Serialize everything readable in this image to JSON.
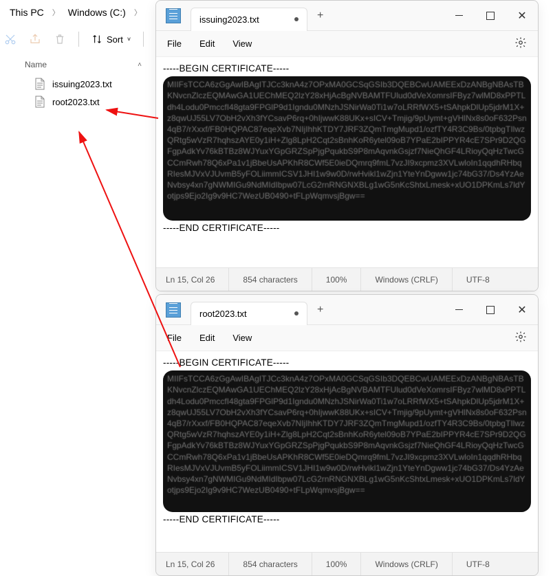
{
  "explorer": {
    "breadcrumbs": [
      "This PC",
      "Windows (C:)"
    ],
    "sort_label": "Sort",
    "name_header": "Name",
    "files": [
      {
        "name": "issuing2023.txt"
      },
      {
        "name": "root2023.txt"
      }
    ]
  },
  "notepad1": {
    "tab_title": "issuing2023.txt",
    "menu": {
      "file": "File",
      "edit": "Edit",
      "view": "View"
    },
    "cert_begin": "-----BEGIN CERTIFICATE-----",
    "cert_end": "-----END CERTIFICATE-----",
    "cert_body": "MIIFsTCCA6zGgAwIBAgITJCc3knA4z7OPxMA0GCSqGSIb3DQEBCwUAMEExDzANBgNBAsTBKNvcnZlczEQMAwGA1UEChMEQ2lzY28xHjAcBgNVBAMTFUlud0dVeXomrsIFByz7wlMD8xPPTLdh4Lodu0PmccfI48gta9FPGlP9d1Igndu0MNzhJSNirWa0Ti1w7oLRRfWX5+tSAhpkDlUp5jdrM1X+z8qwUJ55LV7ObH2vXh3fYCsavP6rq+0hIjwwK88UKx+sICV+Tmjig/9pUymt+gVHlNx8s0oF632Psn4qB7/rXxxf/FB0HQPAC87eqeXvb7NIjIhhKTDY7JRF3ZQmTmgMupd1/ozfTY4R3C9Bs/0tpbgTIlwzQRtg5wVzR7hqhszAYE0y1iH+Zlg8LpH2Cqt2sBnhKoR6ytel09oB7YPaE2bIPPYR4cE7SPr9D2QGFgpAdkYv76kBTBz8WJYuxYGpGRZSpPjgPqukbS9P8mAqvnkGsjzf7NieQhGF4LRioyQqHzTwcGCCmRwh78Q6xPa1v1jBbeUsAPKhR8CWf5E0ieDQmrq9fmL7vzJI9xcpmz3XVLwloIn1qqdhRHbqRIesMJVxVJUvmB5yFOLiimmICSV1JHI1w9w0D/rwHvikl1wZjn1YteYnDgww1jc74bG37/Ds4YzAeNvbsy4xn7gNWMIGu9NdMIdIbpw07LcG2rnRNGNXBLg1wG5nKcShtxLmesk+xUO1DPKmLs7ldYotjps9Ejo2Ig9v9HC7WezUB0490+tFLpWqmvsjBgw==",
    "status": {
      "pos": "Ln 15, Col 26",
      "chars": "854 characters",
      "zoom": "100%",
      "eol": "Windows (CRLF)",
      "enc": "UTF-8"
    }
  },
  "notepad2": {
    "tab_title": "root2023.txt",
    "menu": {
      "file": "File",
      "edit": "Edit",
      "view": "View"
    },
    "cert_begin": "-----BEGIN CERTIFICATE-----",
    "cert_end": "-----END CERTIFICATE-----",
    "cert_body": "MIIFsTCCA6zGgAwIBAgITJCc3knA4z7OPxMA0GCSqGSIb3DQEBCwUAMEExDzANBgNBAsTBKNvcnZlczEQMAwGA1UEChMEQ2lzY28xHjAcBgNVBAMTFUlud0dVeXomrsIFByz7wlMD8xPPTLdh4Lodu0PmccfI48gta9FPGlP9d1Igndu0MNzhJSNirWa0Ti1w7oLRRfWX5+tSAhpkDlUp5jdrM1X+z8qwUJ55LV7ObH2vXh3fYCsavP6rq+0hIjwwK88UKx+sICV+Tmjig/9pUymt+gVHlNx8s0oF632Psn4qB7/rXxxf/FB0HQPAC87eqeXvb7NIjIhhKTDY7JRF3ZQmTmgMupd1/ozfTY4R3C9Bs/0tpbgTIlwzQRtg5wVzR7hqhszAYE0y1iH+Zlg8LpH2Cqt2sBnhKoR6ytel09oB7YPaE2bIPPYR4cE7SPr9D2QGFgpAdkYv76kBTBz8WJYuxYGpGRZSpPjgPqukbS9P8mAqvnkGsjzf7NieQhGF4LRioyQqHzTwcGCCmRwh78Q6xPa1v1jBbeUsAPKhR8CWf5E0ieDQmrq9fmL7vzJI9xcpmz3XVLwloIn1qqdhRHbqRIesMJVxVJUvmB5yFOLiimmICSV1JHI1w9w0D/rwHvikl1wZjn1YteYnDgww1jc74bG37/Ds4YzAeNvbsy4xn7gNWMIGu9NdMIdIbpw07LcG2rnRNGNXBLg1wG5nKcShtxLmesk+xUO1DPKmLs7ldYotjps9Ejo2Ig9v9HC7WezUB0490+tFLpWqmvsjBgw==",
    "status": {
      "pos": "Ln 15, Col 26",
      "chars": "854 characters",
      "zoom": "100%",
      "eol": "Windows (CRLF)",
      "enc": "UTF-8"
    }
  }
}
